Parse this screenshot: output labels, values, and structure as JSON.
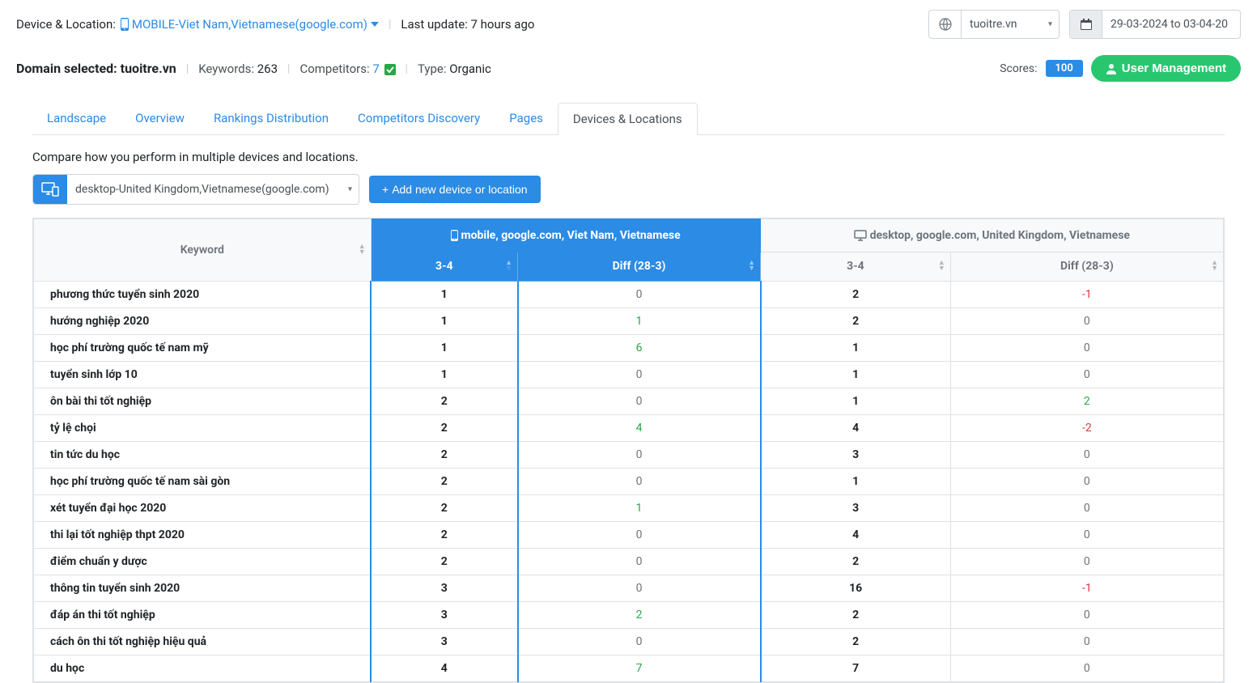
{
  "topbar": {
    "device_location_label": "Device & Location:",
    "device_location_value": "MOBILE-Viet Nam,Vietnamese(google.com)",
    "last_update": "Last update: 7 hours ago",
    "domain_select": "tuoitre.vn",
    "date_range": "29-03-2024 to 03-04-20"
  },
  "subbar": {
    "domain_label": "Domain selected: ",
    "domain_value": "tuoitre.vn",
    "keywords_label": "Keywords: ",
    "keywords_value": "263",
    "competitors_label": "Competitors: ",
    "competitors_value": "7",
    "type_label": "Type: ",
    "type_value": "Organic",
    "scores_label": "Scores:",
    "scores_value": "100",
    "user_mgmt": "User Management"
  },
  "tabs": {
    "landscape": "Landscape",
    "overview": "Overview",
    "rankings": "Rankings Distribution",
    "competitors": "Competitors Discovery",
    "pages": "Pages",
    "devices": "Devices & Locations"
  },
  "compare_text": "Compare how you perform in multiple devices and locations.",
  "controls": {
    "device_select": "desktop-United Kingdom,Vietnamese(google.com)",
    "add_button": "Add new device or location"
  },
  "table": {
    "keyword_header": "Keyword",
    "mobile_header": "mobile, google.com, Viet Nam, Vietnamese",
    "desktop_header": "desktop, google.com, United Kingdom, Vietnamese",
    "sub_34": "3-4",
    "sub_diff": "Diff (28-3)",
    "rows": [
      {
        "kw": "phương thức tuyển sinh 2020",
        "m34": "1",
        "mdiff": "0",
        "d34": "2",
        "ddiff": "-1"
      },
      {
        "kw": "hướng nghiệp 2020",
        "m34": "1",
        "mdiff": "1",
        "d34": "2",
        "ddiff": "0"
      },
      {
        "kw": "học phí trường quốc tế nam mỹ",
        "m34": "1",
        "mdiff": "6",
        "d34": "1",
        "ddiff": "0"
      },
      {
        "kw": "tuyển sinh lớp 10",
        "m34": "1",
        "mdiff": "0",
        "d34": "1",
        "ddiff": "0"
      },
      {
        "kw": "ôn bài thi tốt nghiệp",
        "m34": "2",
        "mdiff": "0",
        "d34": "1",
        "ddiff": "2"
      },
      {
        "kw": "tỷ lệ chọi",
        "m34": "2",
        "mdiff": "4",
        "d34": "4",
        "ddiff": "-2"
      },
      {
        "kw": "tin tức du học",
        "m34": "2",
        "mdiff": "0",
        "d34": "3",
        "ddiff": "0"
      },
      {
        "kw": "học phí trường quốc tế nam sài gòn",
        "m34": "2",
        "mdiff": "0",
        "d34": "1",
        "ddiff": "0"
      },
      {
        "kw": "xét tuyển đại học 2020",
        "m34": "2",
        "mdiff": "1",
        "d34": "3",
        "ddiff": "0"
      },
      {
        "kw": "thi lại tốt nghiệp thpt 2020",
        "m34": "2",
        "mdiff": "0",
        "d34": "4",
        "ddiff": "0"
      },
      {
        "kw": "điểm chuẩn y dược",
        "m34": "2",
        "mdiff": "0",
        "d34": "2",
        "ddiff": "0"
      },
      {
        "kw": "thông tin tuyển sinh 2020",
        "m34": "3",
        "mdiff": "0",
        "d34": "16",
        "ddiff": "-1"
      },
      {
        "kw": "đáp án thi tốt nghiệp",
        "m34": "3",
        "mdiff": "2",
        "d34": "2",
        "ddiff": "0"
      },
      {
        "kw": "cách ôn thi tốt nghiệp hiệu quả",
        "m34": "3",
        "mdiff": "0",
        "d34": "2",
        "ddiff": "0"
      },
      {
        "kw": "du học",
        "m34": "4",
        "mdiff": "7",
        "d34": "7",
        "ddiff": "0"
      }
    ]
  }
}
